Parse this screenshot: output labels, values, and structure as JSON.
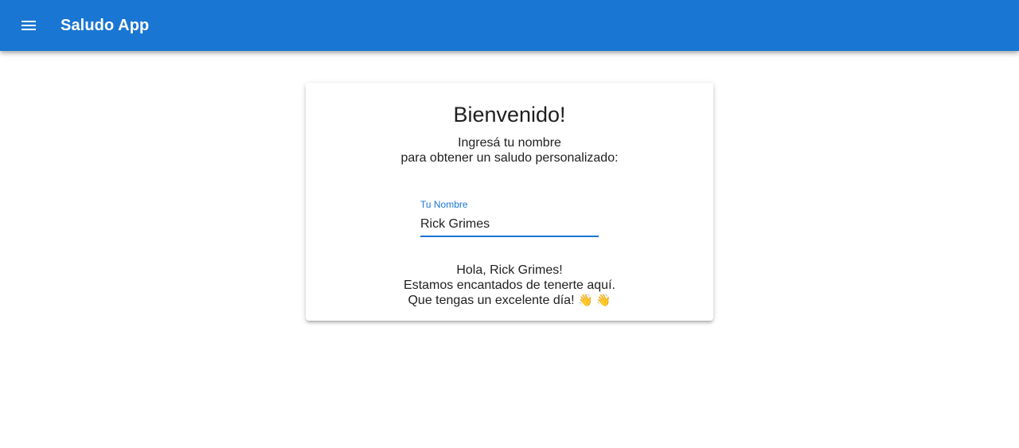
{
  "app": {
    "title": "Saludo App",
    "menu_icon": "menu-icon"
  },
  "card": {
    "title": "Bienvenido!",
    "subtitle_line1": "Ingresá tu nombre",
    "subtitle_line2": "para obtener un saludo personalizado:",
    "input": {
      "label": "Tu Nombre",
      "value": "Rick Grimes"
    },
    "greeting_line1": "Hola, Rick Grimes!",
    "greeting_line2": "Estamos encantados de tenerte aquí.",
    "greeting_line3": "Que tengas un excelente día!",
    "emoji": "👋 👋"
  },
  "colors": {
    "primary": "#1976d2",
    "background": "#ffffff",
    "text": "#212121"
  }
}
